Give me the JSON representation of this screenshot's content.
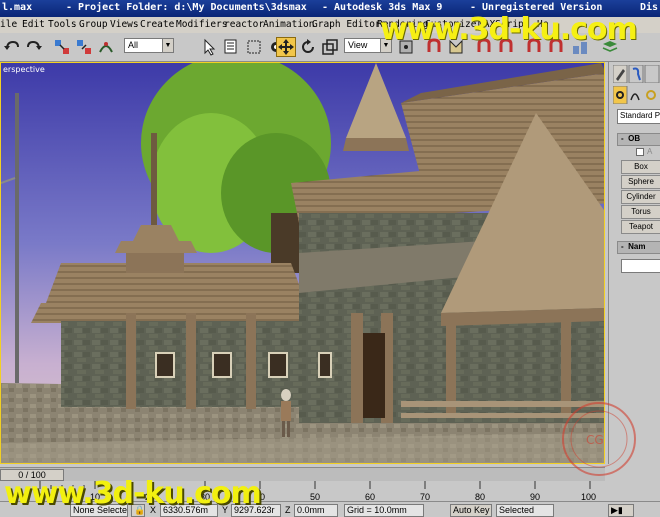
{
  "window": {
    "title_file": "l.max",
    "title_folder": "- Project Folder: d:\\My Documents\\3dsmax",
    "title_app": "- Autodesk 3ds Max 9",
    "title_license": "- Unregistered Version",
    "title_right": "Dis"
  },
  "menu": {
    "items": [
      "ile",
      "Edit",
      "Tools",
      "Group",
      "Views",
      "Create",
      "Modifiers",
      "reactor",
      "Animation",
      "Graph Editors",
      "Rendering",
      "Customize",
      "MAXScript",
      "He"
    ]
  },
  "toolbar": {
    "selection_filter": "All",
    "reference_coord": "View"
  },
  "viewport": {
    "label": "erspective"
  },
  "command_panel": {
    "category_dropdown": "Standard Primitives",
    "object_type_rollout": "OB",
    "autogrid_label": "A",
    "buttons": [
      "Box",
      "Sphere",
      "Cylinder",
      "Torus",
      "Teapot"
    ],
    "name_rollout": "Nam"
  },
  "timeline": {
    "frame_display": "0 / 100",
    "ticks": [
      "0",
      "10",
      "20",
      "30",
      "40",
      "50",
      "60",
      "70",
      "80",
      "90",
      "100"
    ]
  },
  "status": {
    "selection": "None Selecte",
    "x_label": "X",
    "x_value": "6330.576m",
    "y_label": "Y",
    "y_value": "9297.623r",
    "z_label": "Z",
    "z_value": "0.0mm",
    "grid": "Grid = 10.0mm",
    "autokey": "Auto Key",
    "selected_dropdown": "Selected"
  },
  "watermark": {
    "top": "www.3d-ku.com",
    "bottom": "www.3d-ku.com"
  },
  "colors": {
    "title_bar": "#0a2576",
    "watermark": "#f6f014",
    "viewport_border": "#f2d023"
  }
}
